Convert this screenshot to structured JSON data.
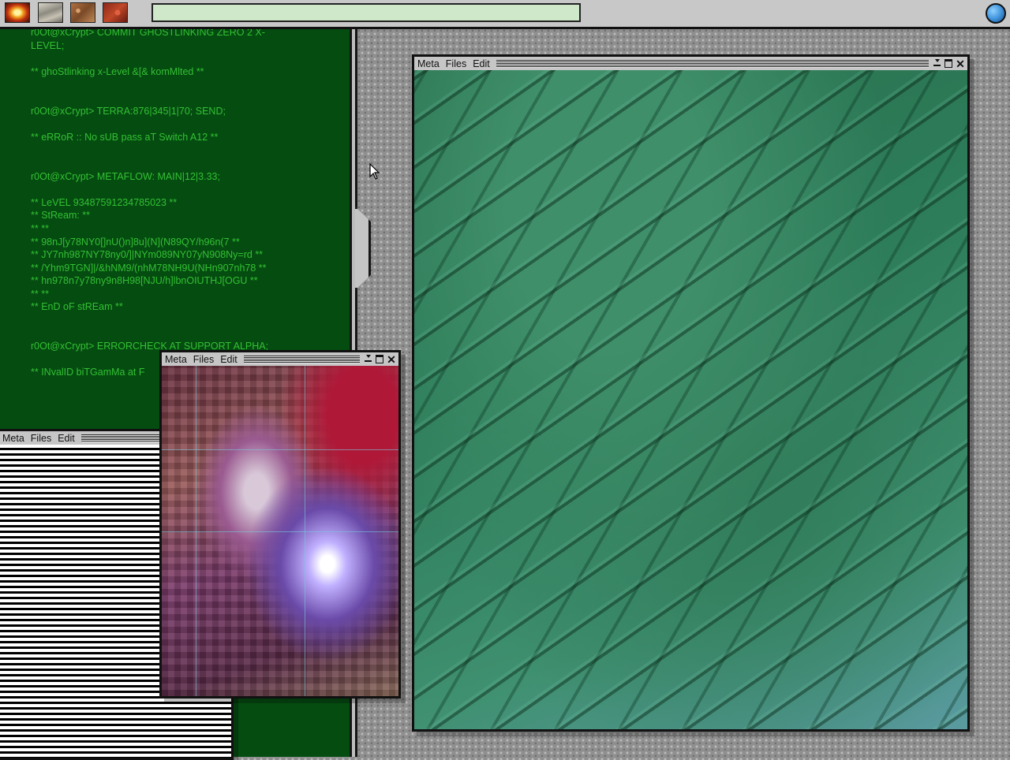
{
  "topbar": {
    "thumbnails": [
      "fire-image",
      "stone-image",
      "rust-image",
      "lava-image"
    ],
    "command_value": "",
    "orb_icon": "globe-icon"
  },
  "terminal": {
    "text_color": "#34c034",
    "background": "#044c10",
    "lines": "r0Ot@xCrypt> COMMIT GHOSTLINKING ZERO 2 X-\nLEVEL;\n\n** ghoStlinking x-Level &[& komMlted **\n\n\nr0Ot@xCrypt> TERRA:876|345|1|70; SEND;\n\n** eRRoR :: No sUB pass aT Switch A12 **\n\n\nr0Ot@xCrypt> METAFLOW: MAIN|12|3.33;\n\n** LeVEL 93487591234785023 **\n** StReam: **\n** **\n** 98nJ[y78NY0[]nU()n]8u](N](N89QY/h96n(7 **\n** JY7nh987NY78ny0/]|NYm089NY07yN908Ny=rd **\n** /Yhm9TGN]|/&hNM9/(nhM78NH9U(NHn907nh78 **\n** hn978n7y78ny9n8H98[NJU/h]lbnOIUTHJ[OGU **\n** **\n** EnD oF stREam **\n\n\nr0Ot@xCrypt> ERRORCHECK AT SUPPORT ALPHA;\n\n** INvalID biTGamMa at F"
  },
  "windows": {
    "terrain": {
      "menu": [
        "Meta",
        "Files",
        "Edit"
      ]
    },
    "pixel": {
      "menu": [
        "Meta",
        "Files",
        "Edit"
      ]
    },
    "stripes": {
      "menu": [
        "Meta",
        "Files",
        "Edit"
      ]
    }
  }
}
